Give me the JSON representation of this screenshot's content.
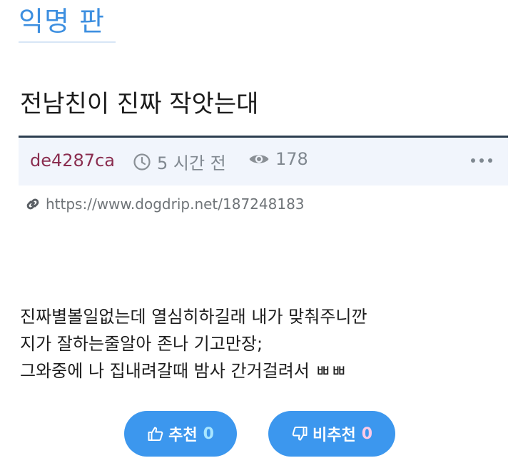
{
  "board": {
    "title": "익명 판"
  },
  "post": {
    "title": "전남친이 진짜 작앗는대",
    "author": "de4287ca",
    "time": "5 시간 전",
    "views": "178",
    "link": "https://www.dogdrip.net/187248183",
    "content_lines": [
      "진짜별볼일없는데 열심히하길래 내가 맞춰주니깐",
      "지가 잘하는줄알아 존나 기고만장;",
      "그와중에 나 집내려갈때 밤사 간거걸려서 ㅃㅃ"
    ]
  },
  "votes": {
    "up_label": "추천",
    "up_count": "0",
    "down_label": "비추천",
    "down_count": "0"
  },
  "icons": {
    "time": "clock-icon",
    "views": "eye-icon",
    "more": "more-dots-icon",
    "link": "link-icon",
    "up": "thumbs-up-icon",
    "down": "thumbs-down-icon"
  },
  "colors": {
    "board_title": "#3d8fe0",
    "author": "#8a2d4f",
    "button": "#3c97ee",
    "up_count": "#a8e6ff",
    "down_count": "#ffc9e6"
  }
}
